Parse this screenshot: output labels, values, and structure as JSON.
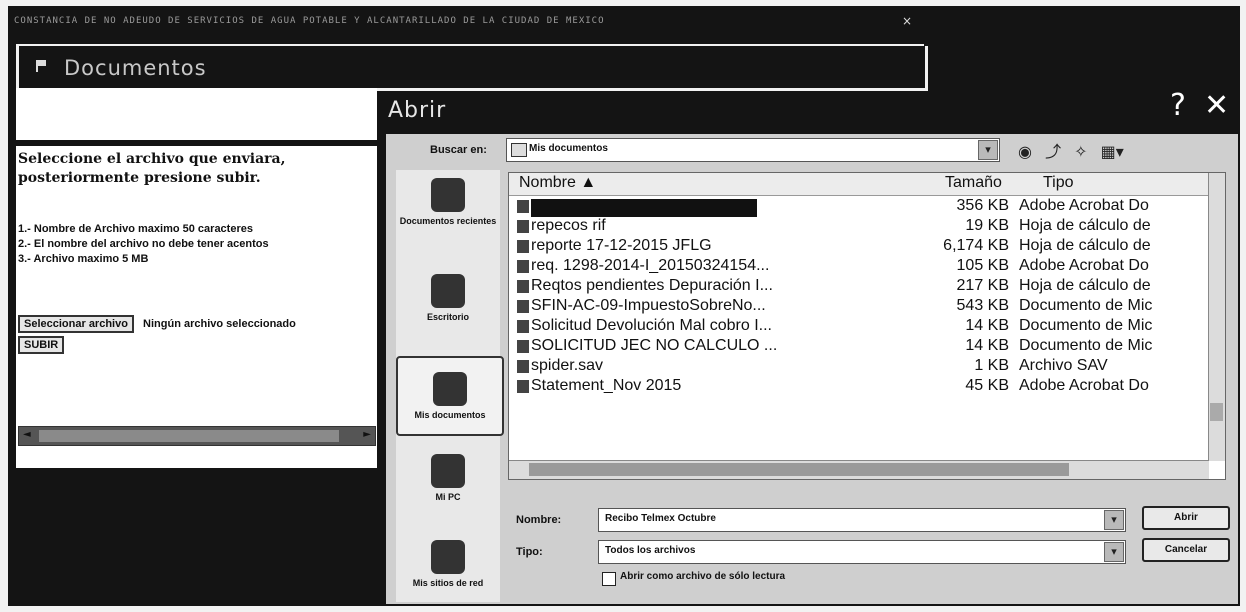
{
  "window": {
    "top_caption": "CONSTANCIA DE NO ADEUDO DE SERVICIOS DE AGUA POTABLE Y ALCANTARILLADO DE LA CIUDAD DE MEXICO",
    "top_close": "×",
    "page_title": "Documentos"
  },
  "upload_panel": {
    "instruction": "Seleccione el archivo que enviara, posteriormente presione subir.",
    "rule_1": "1.- Nombre de Archivo maximo 50 caracteres",
    "rule_2": "2.- El nombre del archivo no debe tener acentos",
    "rule_3": "3.- Archivo maximo 5 MB",
    "select_button": "Seleccionar archivo",
    "no_file_text": "Ningún archivo seleccionado",
    "upload_button": "SUBIR",
    "scroll_left": "◄",
    "scroll_right": "►"
  },
  "dialog": {
    "title": "Abrir",
    "help": "?",
    "close": "✕",
    "look_in_label": "Buscar en:",
    "look_in_value": "Mis documentos",
    "toolbar_icons": [
      "back-icon",
      "up-folder-icon",
      "new-folder-icon",
      "views-menu-icon"
    ],
    "places": [
      {
        "label": "Documentos recientes",
        "icon": "recent-documents-icon"
      },
      {
        "label": "Escritorio",
        "icon": "desktop-icon"
      },
      {
        "label": "Mis documentos",
        "icon": "my-documents-icon",
        "selected": true
      },
      {
        "label": "Mi PC",
        "icon": "my-computer-icon"
      },
      {
        "label": "Mis sitios de red",
        "icon": "network-places-icon"
      }
    ],
    "columns": {
      "name": "Nombre ▲",
      "size": "Tamaño",
      "type": "Tipo"
    },
    "files": [
      {
        "name": "",
        "size": "356 KB",
        "type": "Adobe Acrobat Do",
        "redacted": true
      },
      {
        "name": "repecos rif",
        "size": "19 KB",
        "type": "Hoja de cálculo de"
      },
      {
        "name": "reporte 17-12-2015 JFLG",
        "size": "6,174 KB",
        "type": "Hoja de cálculo de"
      },
      {
        "name": "req. 1298-2014-I_20150324154...",
        "size": "105 KB",
        "type": "Adobe Acrobat Do"
      },
      {
        "name": "Reqtos pendientes Depuración I...",
        "size": "217 KB",
        "type": "Hoja de cálculo de"
      },
      {
        "name": "SFIN-AC-09-ImpuestoSobreNo...",
        "size": "543 KB",
        "type": "Documento de Mic"
      },
      {
        "name": "Solicitud Devolución Mal cobro I...",
        "size": "14 KB",
        "type": "Documento de Mic"
      },
      {
        "name": "SOLICITUD JEC NO CALCULO ...",
        "size": "14 KB",
        "type": "Documento de Mic"
      },
      {
        "name": "spider.sav",
        "size": "1 KB",
        "type": "Archivo SAV"
      },
      {
        "name": "Statement_Nov 2015",
        "size": "45 KB",
        "type": "Adobe Acrobat Do"
      },
      {
        "name": "",
        "size": "",
        "type": ""
      }
    ],
    "filename_label": "Nombre:",
    "filename_value": "Recibo Telmex Octubre",
    "filetype_label": "Tipo:",
    "filetype_value": "Todos los archivos",
    "readonly_label": "Abrir como archivo de sólo lectura",
    "open_button": "Abrir",
    "cancel_button": "Cancelar",
    "combo_arrow": "▾"
  }
}
